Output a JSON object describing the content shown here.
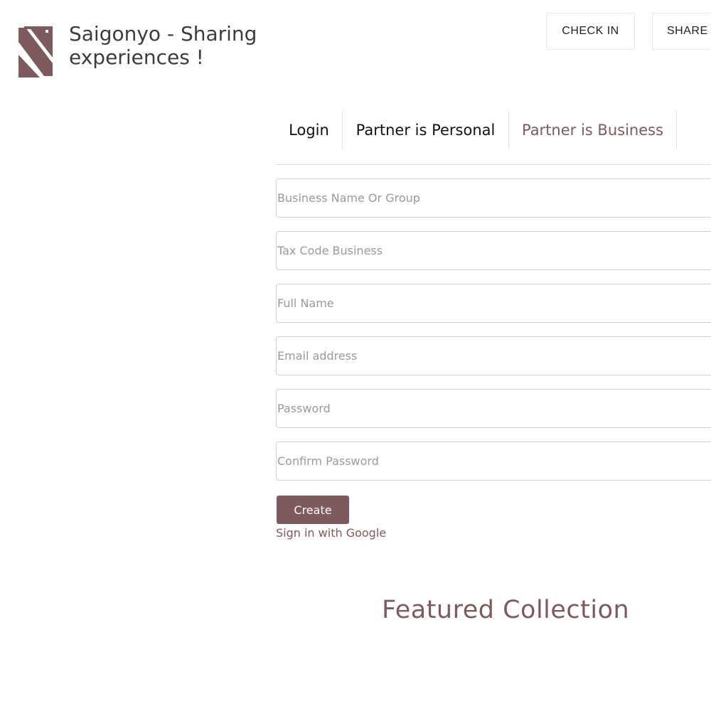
{
  "header": {
    "site_title": "Saigonyo - Sharing experiences !",
    "logo_icon": "saigonyo-s-logo",
    "nav": {
      "check_in": "CHECK IN",
      "share": "SHARE"
    }
  },
  "tabs": [
    {
      "label": "Login"
    },
    {
      "label": "Partner is Personal"
    },
    {
      "label": "Partner is Business",
      "active": true
    }
  ],
  "form": {
    "business_name_placeholder": "Business Name Or Group",
    "tax_code_placeholder": "Tax Code Business",
    "full_name_placeholder": "Full Name",
    "email_placeholder": "Email address",
    "password_placeholder": "Password",
    "confirm_password_placeholder": "Confirm Password",
    "create_label": "Create",
    "google_signin_label": "Sign in with Google"
  },
  "featured": {
    "title": "Featured Collection"
  },
  "colors": {
    "accent": "#7e5a5e"
  }
}
